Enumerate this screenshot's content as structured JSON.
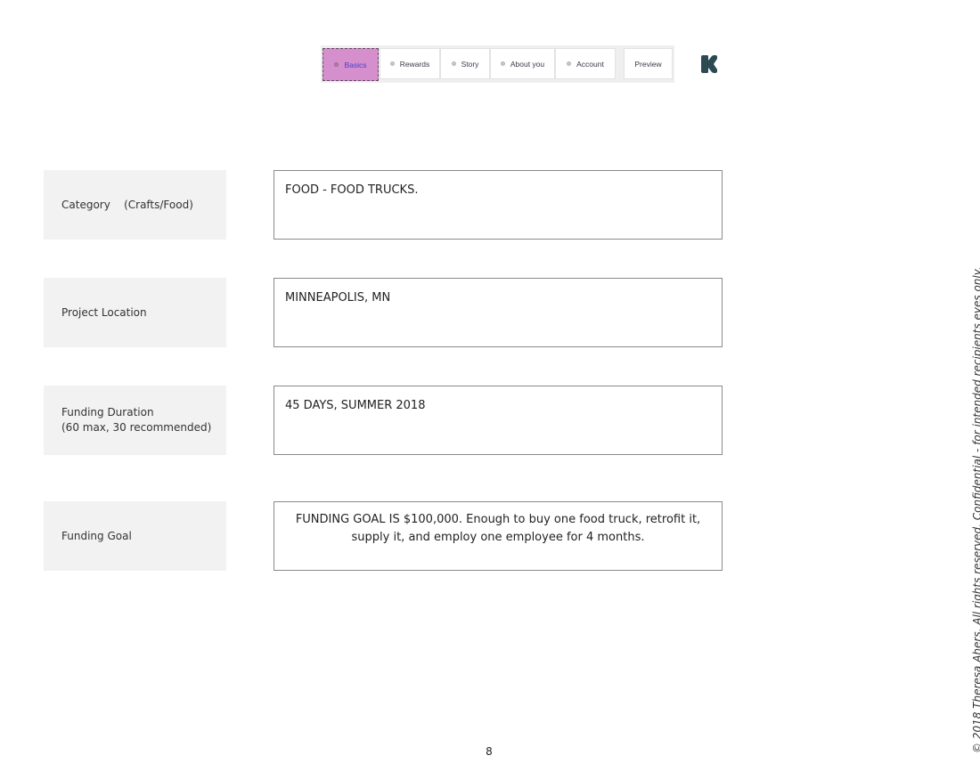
{
  "nav": {
    "tabs": [
      {
        "label": "Basics",
        "active": true
      },
      {
        "label": "Rewards",
        "active": false
      },
      {
        "label": "Story",
        "active": false
      },
      {
        "label": "About you",
        "active": false
      },
      {
        "label": "Account",
        "active": false
      }
    ],
    "preview_label": "Preview",
    "logo_icon": "kickstarter-k-logo",
    "colors": {
      "active_tab_bg": "#d48fcc",
      "active_tab_text": "#4b3ec7",
      "logo": "#2b4a52"
    }
  },
  "form": {
    "rows": [
      {
        "label": "Category    (Crafts/Food)",
        "value": "FOOD - FOOD TRUCKS."
      },
      {
        "label": "Project Location",
        "value": "MINNEAPOLIS, MN"
      },
      {
        "label": "Funding Duration\n(60 max, 30 recommended)",
        "value": "45 DAYS, SUMMER 2018"
      },
      {
        "label": "Funding Goal",
        "value": "FUNDING GOAL IS $100,000. Enough to buy one food truck, retrofit it, supply it, and employ one employee for 4 months."
      }
    ]
  },
  "footer": {
    "page_number": "8",
    "copyright": "© 2018 Theresa Ahers. All rights reserved. Confidential - for intended recipients eyes only."
  }
}
